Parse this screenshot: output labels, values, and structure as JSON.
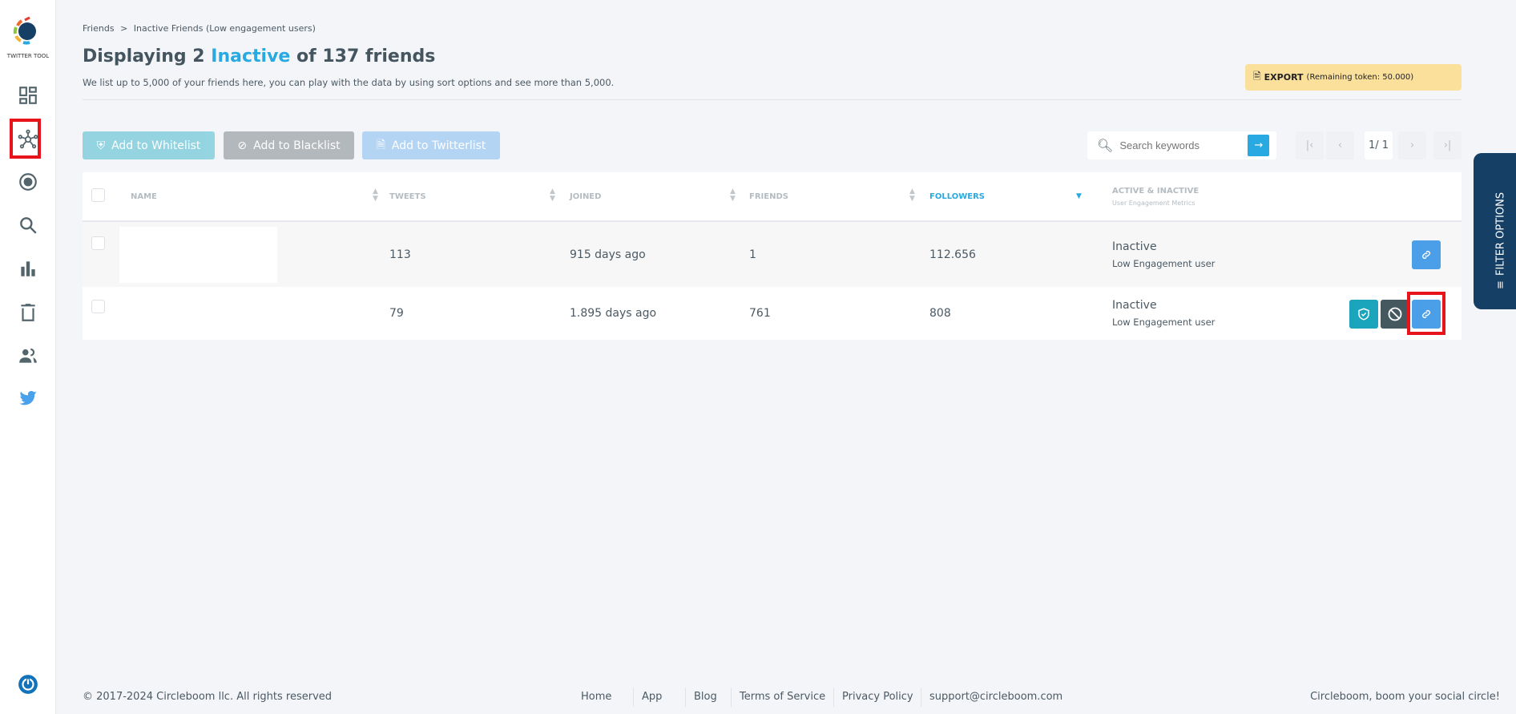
{
  "sidebar": {
    "logo_text": "TWITTER TOOL",
    "items": [
      "dashboard-icon",
      "network-icon",
      "target-icon",
      "search-icon",
      "bar-chart-icon",
      "trash-icon",
      "people-icon",
      "twitter-icon"
    ],
    "active": "network-icon"
  },
  "breadcrumb": {
    "root": "Friends",
    "separator": ">",
    "current": "Inactive Friends (Low engagement users)"
  },
  "header": {
    "title_prefix": "Displaying 2 ",
    "title_highlight": "Inactive",
    "title_suffix": " of 137 friends",
    "subtitle": "We list up to 5,000 of your friends here, you can play with the data by using sort options and see more than 5,000."
  },
  "export": {
    "label": "EXPORT",
    "remaining": "(Remaining token: 50.000)"
  },
  "actions": {
    "whitelist": "Add to Whitelist",
    "blacklist": "Add to Blacklist",
    "twitterlist": "Add to Twitterlist"
  },
  "search": {
    "placeholder": "Search keywords"
  },
  "pagination": {
    "page": "1/ 1"
  },
  "table": {
    "headers": {
      "name": "NAME",
      "tweets": "TWEETS",
      "joined": "JOINED",
      "friends": "FRIENDS",
      "followers": "FOLLOWERS",
      "status": "ACTIVE & INACTIVE",
      "status_sub": "User Engagement Metrics"
    },
    "sorted_by": "FOLLOWERS",
    "rows": [
      {
        "name": "",
        "tweets": "113",
        "joined": "915 days ago",
        "friends": "1",
        "followers": "112.656",
        "status": "Inactive",
        "status_sub": "Low Engagement user"
      },
      {
        "name": "",
        "tweets": "79",
        "joined": "1.895 days ago",
        "friends": "761",
        "followers": "808",
        "status": "Inactive",
        "status_sub": "Low Engagement user"
      }
    ]
  },
  "filter_tab": {
    "label": "FILTER OPTIONS"
  },
  "footer": {
    "copyright": "© 2017-2024 Circleboom llc. All rights reserved",
    "links": [
      "Home",
      "App",
      "Blog",
      "Terms of Service",
      "Privacy Policy",
      "support@circleboom.com"
    ],
    "tagline": "Circleboom, boom your social circle!"
  },
  "colors": {
    "accent": "#29a9e1",
    "whitelist": "#1aa5bd",
    "blacklist": "#46585f",
    "link": "#4a9fe8",
    "export_bg": "#fbe09c",
    "filter_tab": "#153f64",
    "highlight": "#e8141c"
  }
}
